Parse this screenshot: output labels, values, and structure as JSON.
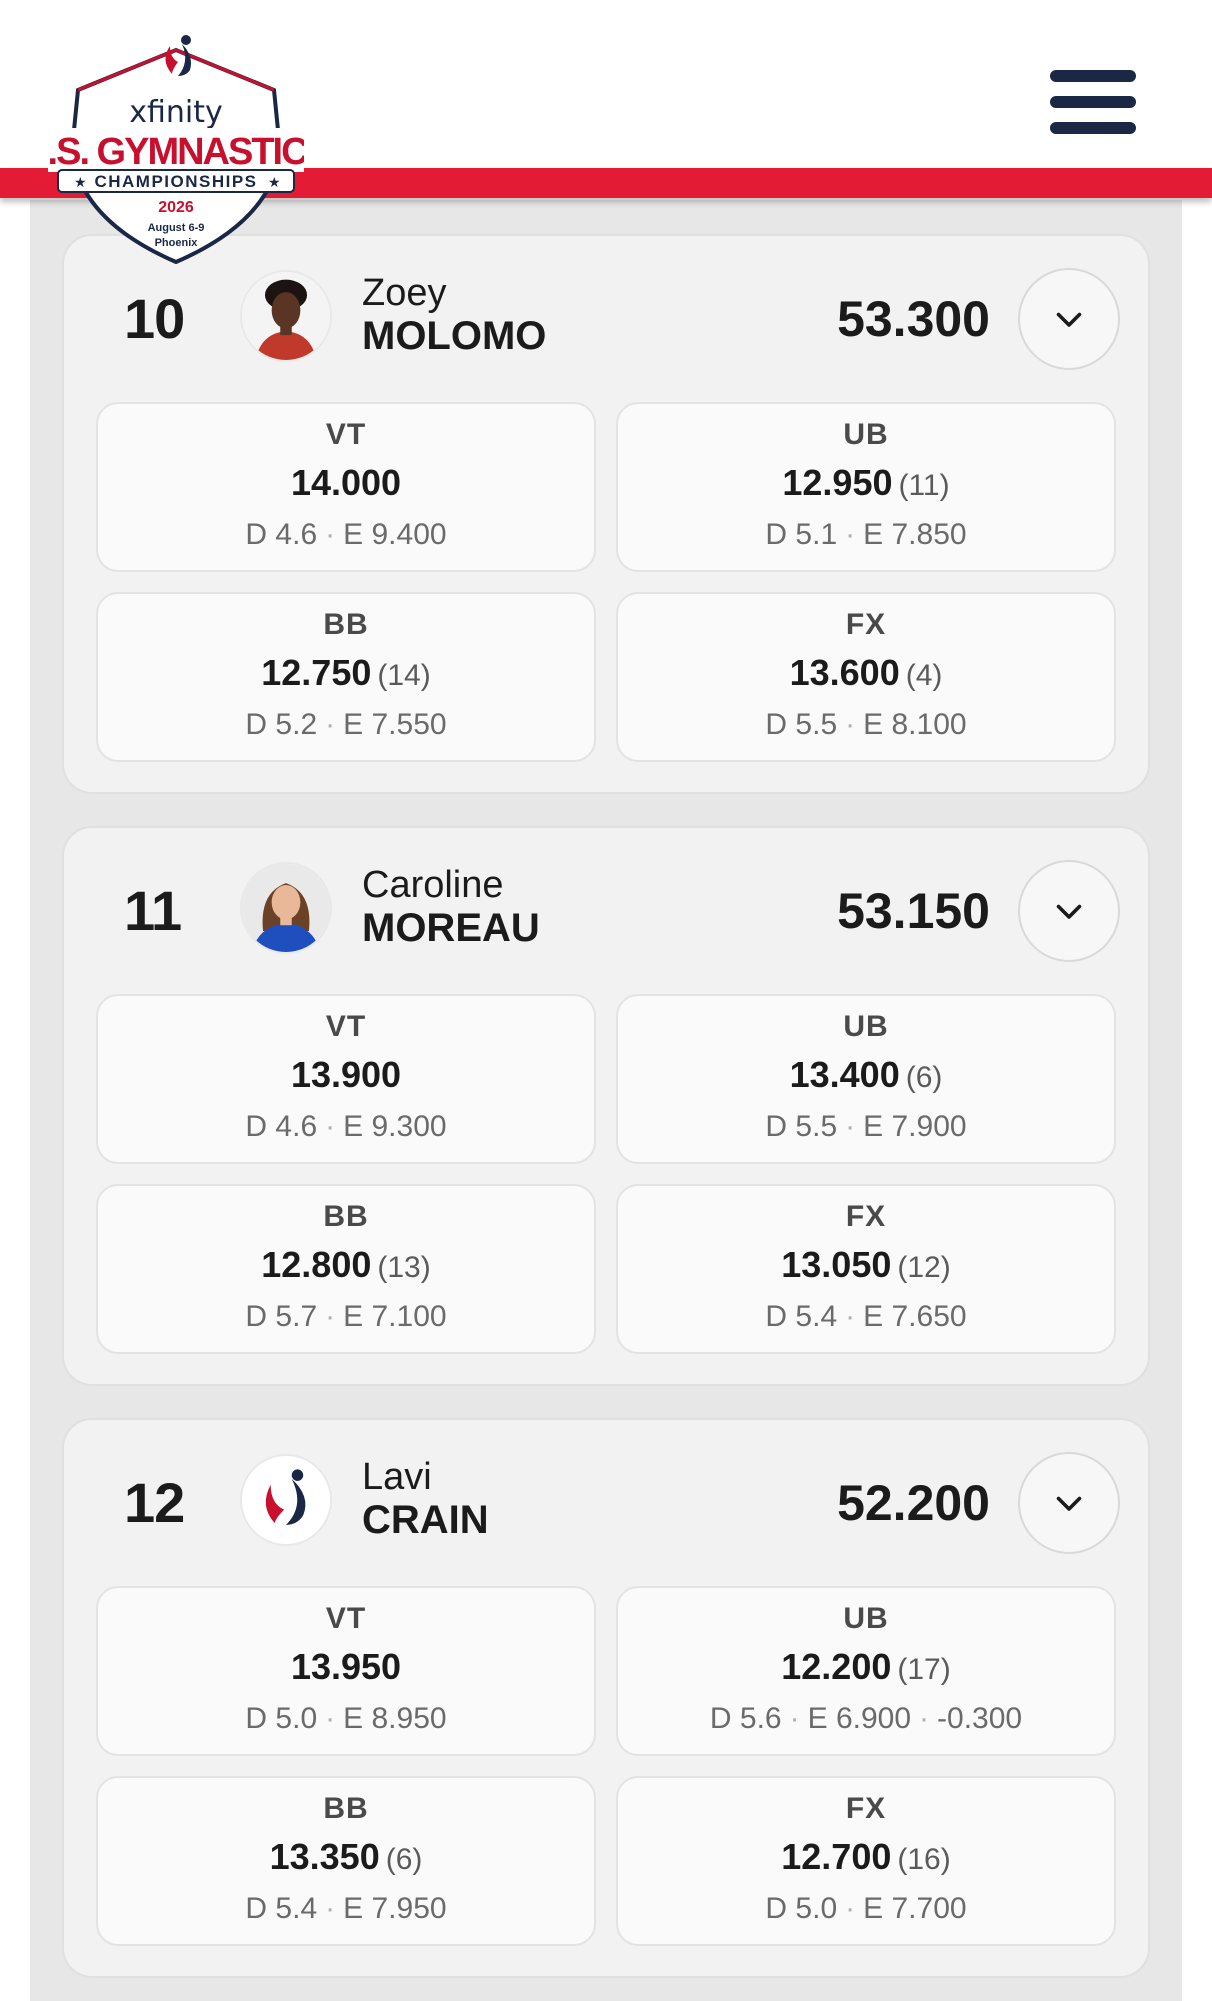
{
  "header": {
    "logo": {
      "brand": "xfinity",
      "title": "U.S. GYMNASTICS",
      "subtitle": "CHAMPIONSHIPS",
      "year": "2026",
      "dates": "August 6-9",
      "city": "Phoenix"
    },
    "menu_icon": "hamburger-menu-icon",
    "colors": {
      "navy": "#1a2845",
      "red": "#e31b35"
    }
  },
  "athletes": [
    {
      "rank": "10",
      "first_name": "Zoey",
      "last_name": "MOLOMO",
      "total": "53.300",
      "events": [
        {
          "name": "VT",
          "score": "14.000",
          "rank": "",
          "d": "D 4.6",
          "e": "E 9.400",
          "penalty": ""
        },
        {
          "name": "UB",
          "score": "12.950",
          "rank": "(11)",
          "d": "D 5.1",
          "e": "E 7.850",
          "penalty": ""
        },
        {
          "name": "BB",
          "score": "12.750",
          "rank": "(14)",
          "d": "D 5.2",
          "e": "E 7.550",
          "penalty": ""
        },
        {
          "name": "FX",
          "score": "13.600",
          "rank": "(4)",
          "d": "D 5.5",
          "e": "E 8.100",
          "penalty": ""
        }
      ]
    },
    {
      "rank": "11",
      "first_name": "Caroline",
      "last_name": "MOREAU",
      "total": "53.150",
      "events": [
        {
          "name": "VT",
          "score": "13.900",
          "rank": "",
          "d": "D 4.6",
          "e": "E 9.300",
          "penalty": ""
        },
        {
          "name": "UB",
          "score": "13.400",
          "rank": "(6)",
          "d": "D 5.5",
          "e": "E 7.900",
          "penalty": ""
        },
        {
          "name": "BB",
          "score": "12.800",
          "rank": "(13)",
          "d": "D 5.7",
          "e": "E 7.100",
          "penalty": ""
        },
        {
          "name": "FX",
          "score": "13.050",
          "rank": "(12)",
          "d": "D 5.4",
          "e": "E 7.650",
          "penalty": ""
        }
      ]
    },
    {
      "rank": "12",
      "first_name": "Lavi",
      "last_name": "CRAIN",
      "total": "52.200",
      "events": [
        {
          "name": "VT",
          "score": "13.950",
          "rank": "",
          "d": "D 5.0",
          "e": "E 8.950",
          "penalty": ""
        },
        {
          "name": "UB",
          "score": "12.200",
          "rank": "(17)",
          "d": "D 5.6",
          "e": "E 6.900",
          "penalty": "-0.300"
        },
        {
          "name": "BB",
          "score": "13.350",
          "rank": "(6)",
          "d": "D 5.4",
          "e": "E 7.950",
          "penalty": ""
        },
        {
          "name": "FX",
          "score": "12.700",
          "rank": "(16)",
          "d": "D 5.0",
          "e": "E 7.700",
          "penalty": ""
        }
      ]
    }
  ]
}
